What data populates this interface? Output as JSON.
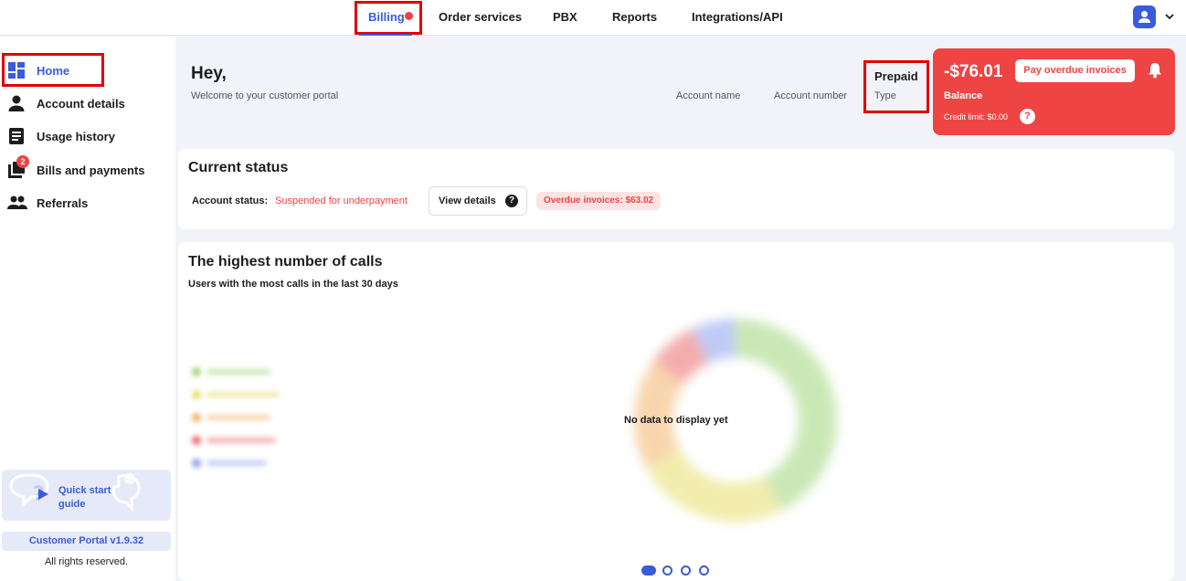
{
  "topnav": {
    "billing": "Billing",
    "order_services": "Order services",
    "pbx": "PBX",
    "reports": "Reports",
    "integrations": "Integrations/API"
  },
  "sidebar": {
    "items": [
      {
        "label": "Home",
        "icon": "dashboard-icon"
      },
      {
        "label": "Account details",
        "icon": "person-icon"
      },
      {
        "label": "Usage history",
        "icon": "document-icon"
      },
      {
        "label": "Bills and payments",
        "icon": "bills-icon",
        "badge": "2"
      },
      {
        "label": "Referrals",
        "icon": "group-icon"
      }
    ],
    "guide": "Quick start guide",
    "version": "Customer Portal v1.9.32",
    "rights": "All rights reserved."
  },
  "header": {
    "greeting": "Hey,",
    "welcome": "Welcome to your customer portal",
    "account_name_label": "Account name",
    "account_number_label": "Account number",
    "type_value": "Prepaid",
    "type_label": "Type"
  },
  "balance": {
    "amount": "-$76.01",
    "label": "Balance",
    "pay_button": "Pay overdue invoices",
    "credit_limit": "Credit limit: $0.00",
    "help": "?"
  },
  "status": {
    "title": "Current status",
    "account_status_label": "Account status:",
    "account_status_value": "Suspended for underpayment",
    "view_details": "View details",
    "help": "?",
    "overdue": "Overdue invoices:  $63.02"
  },
  "calls": {
    "title": "The highest number of calls",
    "subtitle": "Users with the most calls in the last 30 days",
    "no_data": "No data to display yet",
    "active_page": 1,
    "page_count": 4
  },
  "colors": {
    "accent": "#3a5bdc",
    "danger": "#ef4444",
    "chart_green": "#9fd67a",
    "chart_yellow": "#e6de6a",
    "chart_orange": "#f2b36b",
    "chart_red": "#ec6b6b",
    "chart_blue": "#8ea0f0"
  }
}
